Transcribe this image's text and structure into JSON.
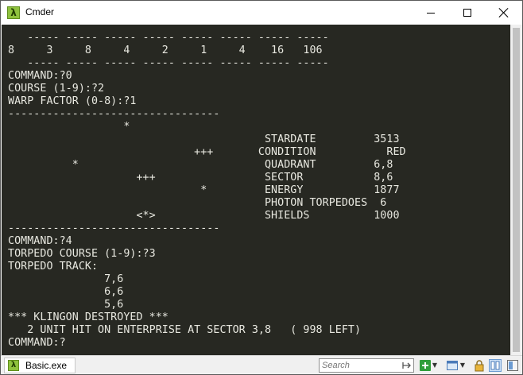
{
  "window": {
    "title": "Cmder"
  },
  "console": {
    "lines": [
      "   ----- ----- ----- ----- ----- ----- ----- -----",
      "8     3     8     4     2     1     4    16   106",
      "   ----- ----- ----- ----- ----- ----- ----- -----",
      "COMMAND:?0",
      "COURSE (1-9):?2",
      "WARP FACTOR (0-8):?1",
      "---------------------------------",
      "                  *",
      "                                        STARDATE         3513",
      "                             +++       CONDITION           RED",
      "          *                             QUADRANT         6,8",
      "                    +++                 SECTOR           8,6",
      "                              *         ENERGY           1877",
      "                                        PHOTON TORPEDOES  6",
      "                    <*>                 SHIELDS          1000",
      "---------------------------------",
      "COMMAND:?4",
      "TORPEDO COURSE (1-9):?3",
      "TORPEDO TRACK:",
      "               7,6",
      "               6,6",
      "               5,6",
      "*** KLINGON DESTROYED ***",
      "   2 UNIT HIT ON ENTERPRISE AT SECTOR 3,8   ( 998 LEFT)",
      "COMMAND:?"
    ]
  },
  "statusbar": {
    "tab_label": "Basic.exe",
    "search_placeholder": "Search"
  },
  "colors": {
    "console_bg": "#272822",
    "console_fg": "#e8e8e0",
    "cmder_green": "#8fc23e"
  }
}
